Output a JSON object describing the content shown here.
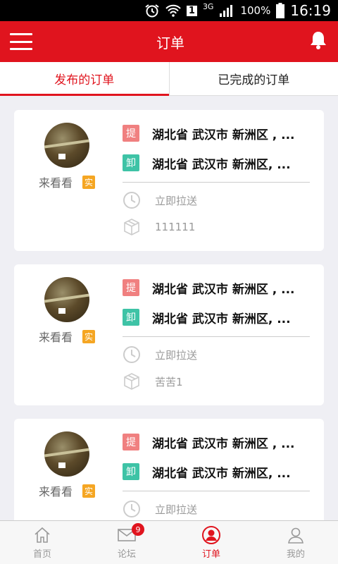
{
  "status_bar": {
    "battery": "100%",
    "network": "3G",
    "sim": "1",
    "time": "16:19"
  },
  "app_bar": {
    "title": "订单"
  },
  "tabs": [
    {
      "label": "发布的订单",
      "active": true
    },
    {
      "label": "已完成的订单",
      "active": false
    }
  ],
  "orders": [
    {
      "user": "来看看",
      "verified_badge": "实",
      "pickup_tag": "提",
      "pickup": "湖北省 武汉市 新洲区 , ...",
      "unload_tag": "卸",
      "unload": "湖北省 武汉市 新洲区, ...",
      "delivery": "立即拉送",
      "cargo": "111111"
    },
    {
      "user": "来看看",
      "verified_badge": "实",
      "pickup_tag": "提",
      "pickup": "湖北省 武汉市 新洲区 , ...",
      "unload_tag": "卸",
      "unload": "湖北省 武汉市 新洲区, ...",
      "delivery": "立即拉送",
      "cargo": "苦苦1"
    },
    {
      "user": "来看看",
      "verified_badge": "实",
      "pickup_tag": "提",
      "pickup": "湖北省 武汉市 新洲区 , ...",
      "unload_tag": "卸",
      "unload": "湖北省 武汉市 新洲区, ...",
      "delivery": "立即拉送",
      "cargo": ""
    }
  ],
  "bottom_nav": [
    {
      "label": "首页",
      "icon": "home-icon",
      "active": false
    },
    {
      "label": "论坛",
      "icon": "mail-icon",
      "active": false,
      "badge": "9"
    },
    {
      "label": "订单",
      "icon": "order-icon",
      "active": true
    },
    {
      "label": "我的",
      "icon": "profile-icon",
      "active": false
    }
  ],
  "colors": {
    "brand": "#e0141e",
    "pickup": "#f08080",
    "unload": "#3ec3a6",
    "badge": "#f5a623"
  }
}
